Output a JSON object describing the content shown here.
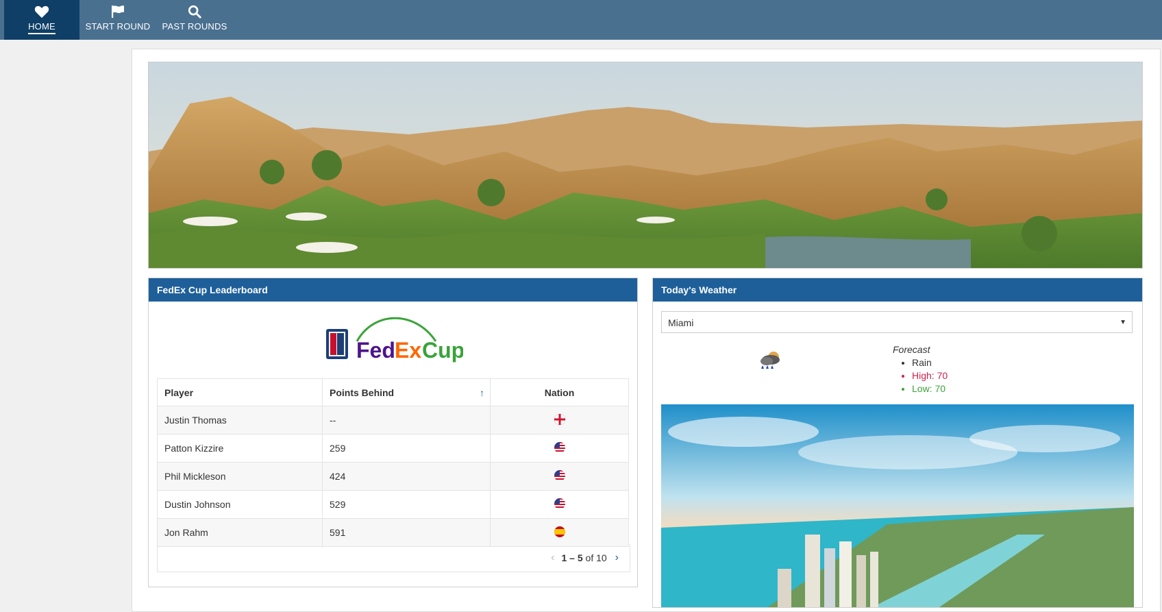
{
  "nav": {
    "home": {
      "label": "HOME",
      "icon": "heart-icon"
    },
    "start_round": {
      "label": "START ROUND",
      "icon": "flag-icon"
    },
    "past_rounds": {
      "label": "PAST ROUNDS",
      "icon": "search-icon"
    }
  },
  "leaderboard": {
    "title": "FedEx Cup Leaderboard",
    "logo_text": "FedExCup",
    "columns": [
      "Player",
      "Points Behind",
      "Nation"
    ],
    "rows": [
      {
        "player": "Justin Thomas",
        "points": "--",
        "nation": "england-flag-icon"
      },
      {
        "player": "Patton Kizzire",
        "points": "259",
        "nation": "usa-flag-icon"
      },
      {
        "player": "Phil Mickleson",
        "points": "424",
        "nation": "usa-flag-icon"
      },
      {
        "player": "Dustin Johnson",
        "points": "529",
        "nation": "usa-flag-icon"
      },
      {
        "player": "Jon Rahm",
        "points": "591",
        "nation": "spain-flag-icon"
      }
    ],
    "pager": {
      "range": "1 – 5",
      "of": "of 10"
    }
  },
  "weather": {
    "title": "Today's Weather",
    "city": "Miami",
    "forecast_title": "Forecast",
    "condition": "Rain",
    "high": "High: 70",
    "low": "Low: 70"
  },
  "colors": {
    "nav_bg": "#4a7090",
    "nav_active": "#0f3f66",
    "card_header": "#1e5f99",
    "high": "#d0204a",
    "low": "#3aa33a"
  }
}
